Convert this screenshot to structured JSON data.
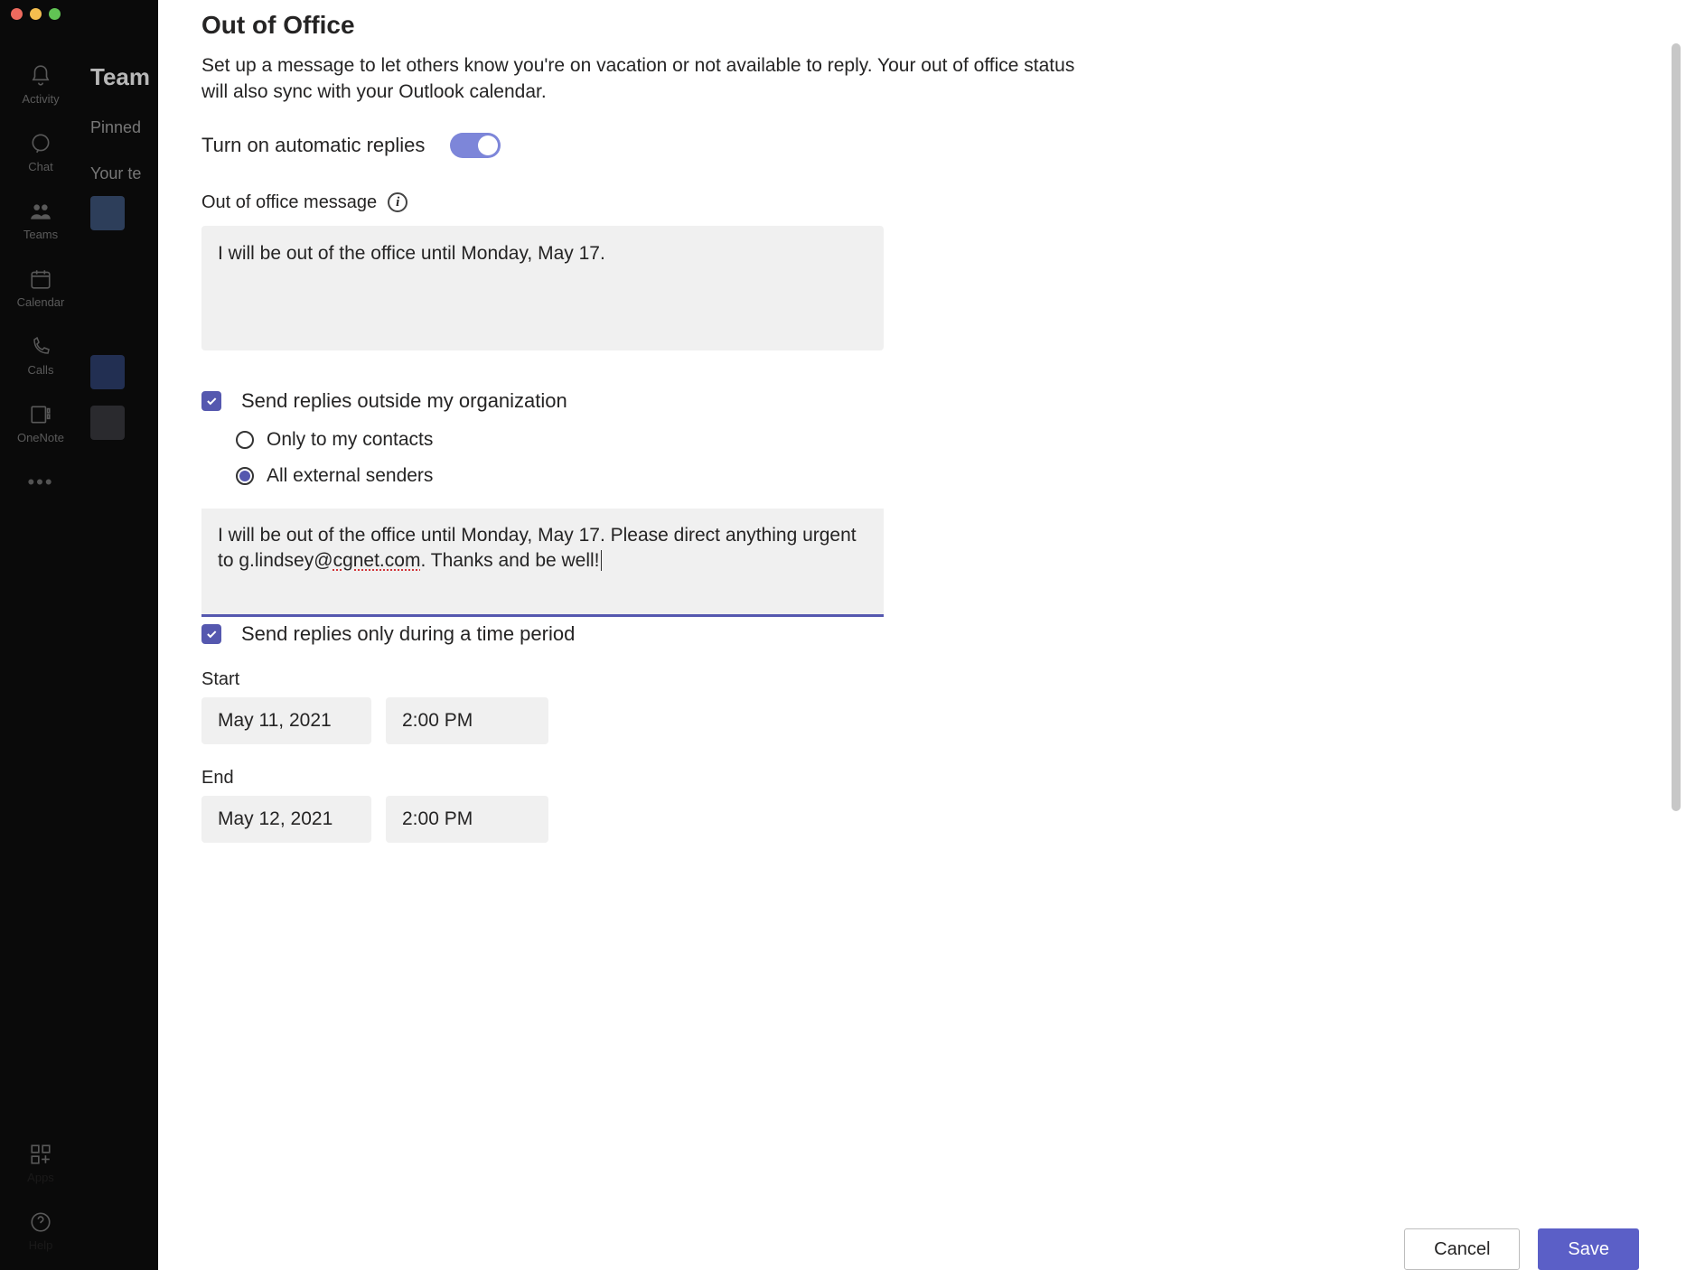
{
  "rail": {
    "activity": "Activity",
    "chat": "Chat",
    "teams": "Teams",
    "calendar": "Calendar",
    "calls": "Calls",
    "onenote": "OneNote",
    "apps": "Apps",
    "help": "Help"
  },
  "bg": {
    "title": "Team",
    "pinned": "Pinned",
    "yourteams": "Your te"
  },
  "dialog": {
    "title": "Out of Office",
    "description": "Set up a message to let others know you're on vacation or not available to reply. Your out of office status will also sync with your Outlook calendar.",
    "auto_replies_label": "Turn on automatic replies",
    "auto_replies_on": true,
    "message_label": "Out of office message",
    "message_value": "I will be out of the office until Monday, May 17.",
    "send_outside": {
      "label": "Send replies outside my organization",
      "checked": true,
      "options": {
        "contacts": "Only to my contacts",
        "all": "All external senders",
        "selected": "all"
      },
      "message_prefix": "I will be out of the office until Monday, May 17.  Please direct anything urgent to g.lindsey@",
      "message_misspelled": "cgnet.com",
      "message_suffix": ".  Thanks and be well!"
    },
    "time_period": {
      "label": "Send replies only during a time period",
      "checked": true,
      "start_label": "Start",
      "end_label": "End",
      "start_date": "May 11, 2021",
      "start_time": "2:00 PM",
      "end_date": "May 12, 2021",
      "end_time": "2:00 PM"
    },
    "footer": {
      "cancel": "Cancel",
      "save": "Save"
    }
  }
}
